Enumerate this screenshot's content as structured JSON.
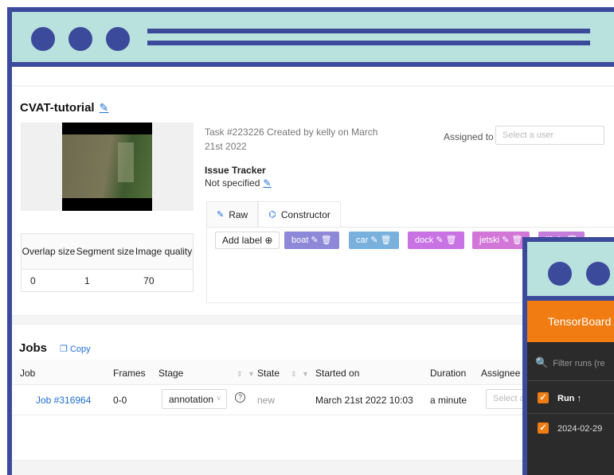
{
  "task": {
    "title": "CVAT-tutorial",
    "meta": "Task #223226 Created by kelly on March 21st 2022",
    "assigned_label": "Assigned to",
    "assignee_placeholder": "Select a user",
    "issue_tracker_title": "Issue Tracker",
    "issue_tracker_value": "Not specified"
  },
  "stats": {
    "headers": [
      "Overlap size",
      "Segment size",
      "Image quality"
    ],
    "values": [
      "0",
      "1",
      "70"
    ]
  },
  "tabs": [
    {
      "label": "Raw",
      "icon": "pencil-icon"
    },
    {
      "label": "Constructor",
      "icon": "build-icon"
    }
  ],
  "add_label": "Add label",
  "labels": [
    {
      "name": "boat",
      "color": "#8e88d8"
    },
    {
      "name": "car",
      "color": "#7ab1dc"
    },
    {
      "name": "dock",
      "color": "#c872e4"
    },
    {
      "name": "jetski",
      "color": "#d277d8"
    },
    {
      "name": "lift",
      "color": "#c57ddc"
    }
  ],
  "jobs": {
    "title": "Jobs",
    "copy": "Copy",
    "headers": [
      "Job",
      "Frames",
      "Stage",
      "State",
      "Started on",
      "Duration",
      "Assignee"
    ],
    "rows": [
      {
        "job": "Job #316964",
        "frames": "0-0",
        "stage": "annotation",
        "state": "new",
        "started": "March 21st 2022 10:03",
        "duration": "a minute",
        "assignee_placeholder": "Select a u"
      }
    ]
  },
  "tensorboard": {
    "title": "TensorBoard",
    "search_placeholder": "Filter runs (re",
    "run_header": "Run ↑",
    "run_date": "2024-02-29",
    "accent": "#f07c12"
  },
  "colors": {
    "frame": "#3b4a9a",
    "chrome": "#b9e1dd",
    "link": "#1f6fd6"
  }
}
